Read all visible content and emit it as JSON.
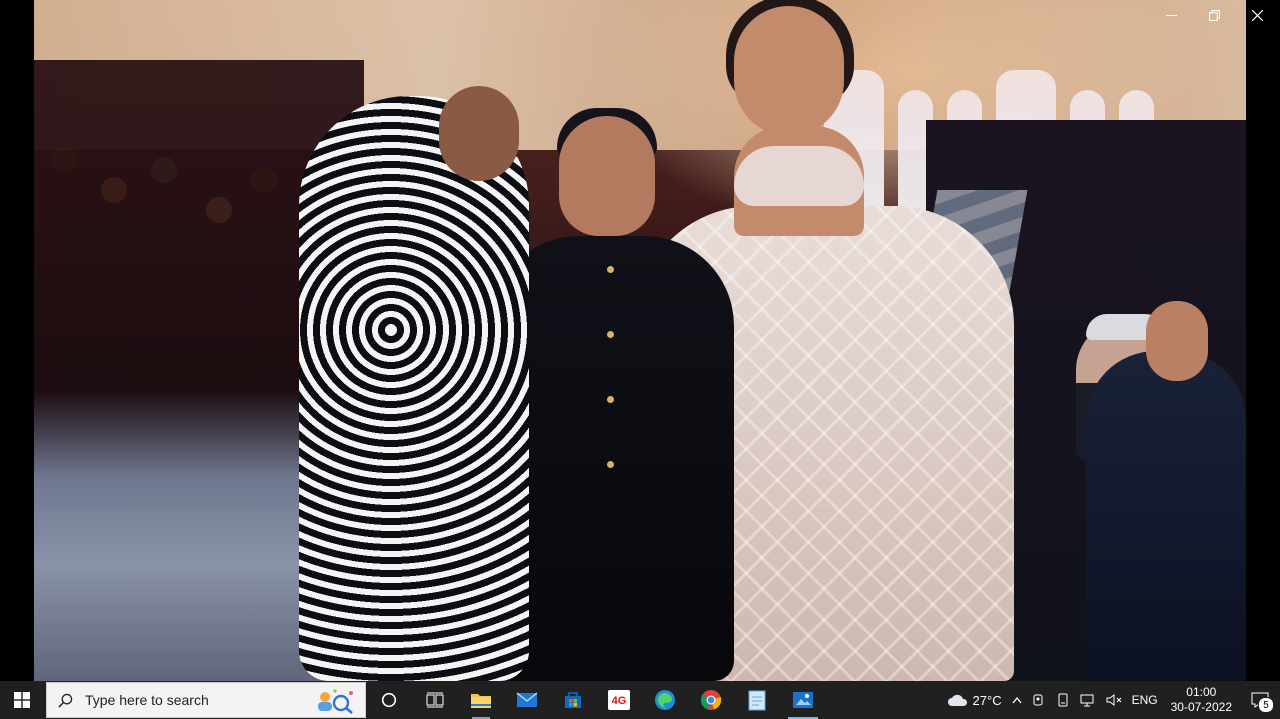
{
  "window": {
    "controls": {
      "minimize_icon": "minimize-icon",
      "restore_icon": "restore-icon",
      "close_icon": "close-icon"
    }
  },
  "photo": {
    "subject": "fashion-runway-photo"
  },
  "taskbar": {
    "search": {
      "placeholder": "Type here to search"
    },
    "pinned": [
      {
        "name": "task-view",
        "icon": "task-view-icon"
      },
      {
        "name": "file-explorer",
        "icon": "folder-icon"
      },
      {
        "name": "mail",
        "icon": "mail-icon"
      },
      {
        "name": "microsoft-store",
        "icon": "store-icon"
      },
      {
        "name": "app-40",
        "icon": "app-tile-icon",
        "label": "4G"
      },
      {
        "name": "edge",
        "icon": "edge-icon"
      },
      {
        "name": "chrome",
        "icon": "chrome-icon"
      },
      {
        "name": "notepad",
        "icon": "notepad-icon"
      },
      {
        "name": "photos",
        "icon": "photos-icon"
      }
    ],
    "tray": {
      "temperature": "27°C",
      "language": "ENG",
      "time": "01:00",
      "date": "30-07-2022",
      "notifications_count": "5"
    }
  }
}
